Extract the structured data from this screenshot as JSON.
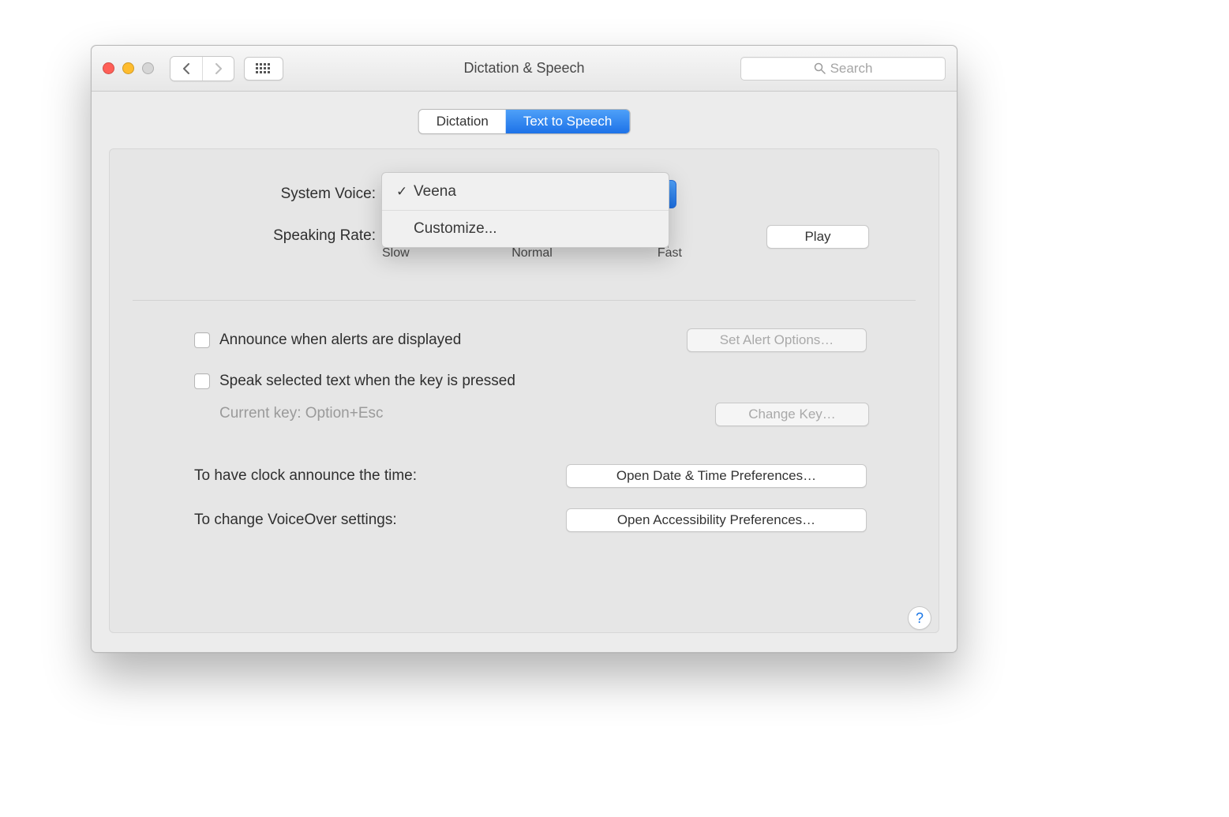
{
  "window": {
    "title": "Dictation & Speech"
  },
  "toolbar": {
    "search_placeholder": "Search"
  },
  "tabs": {
    "dictation": "Dictation",
    "text_to_speech": "Text to Speech"
  },
  "voice": {
    "label": "System Voice:",
    "menu": {
      "selected": "Veena",
      "customize": "Customize..."
    }
  },
  "rate": {
    "label": "Speaking Rate:",
    "slow": "Slow",
    "normal": "Normal",
    "fast": "Fast",
    "play": "Play"
  },
  "alerts": {
    "announce_label": "Announce when alerts are displayed",
    "set_options": "Set Alert Options…"
  },
  "speak_selected": {
    "label": "Speak selected text when the key is pressed",
    "current_key": "Current key: Option+Esc",
    "change_key": "Change Key…"
  },
  "clock": {
    "label": "To have clock announce the time:",
    "button": "Open Date & Time Preferences…"
  },
  "voiceover": {
    "label": "To change VoiceOver settings:",
    "button": "Open Accessibility Preferences…"
  },
  "help": "?"
}
